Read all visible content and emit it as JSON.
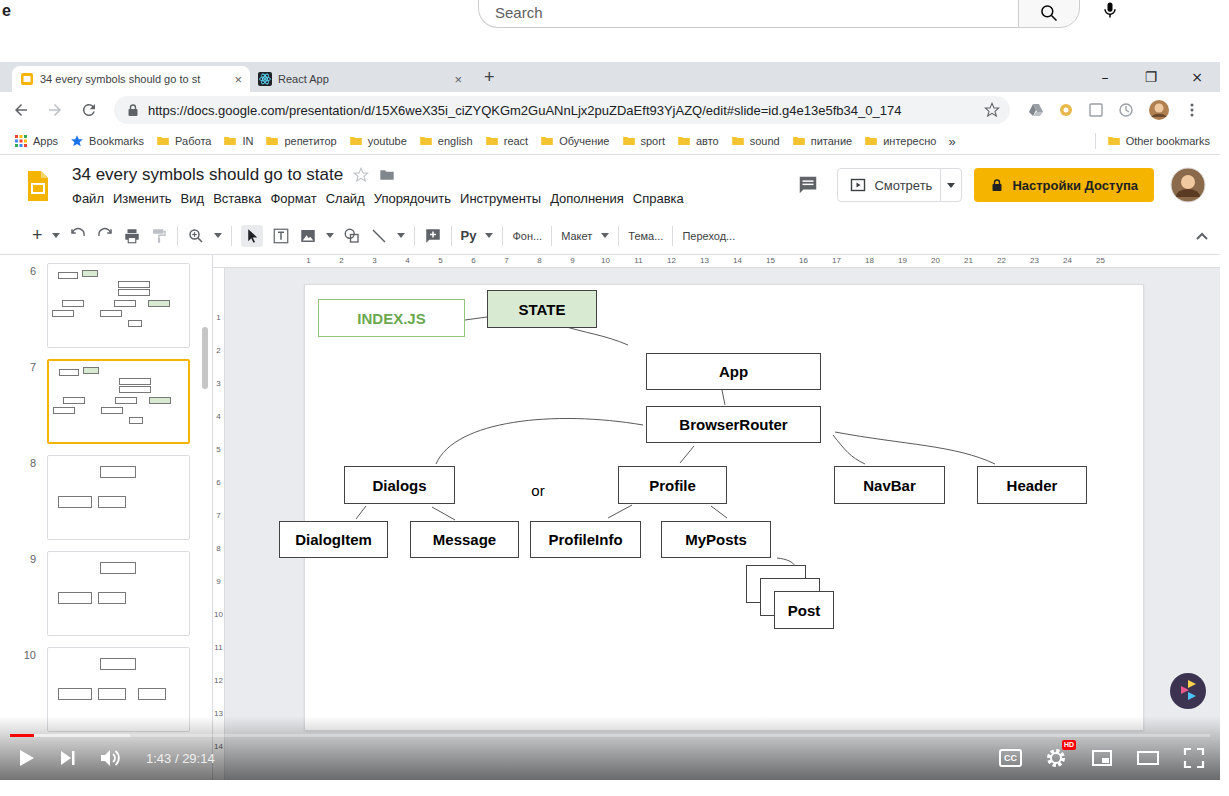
{
  "youtube": {
    "logo_fragment": "e",
    "search": {
      "placeholder": "Search"
    }
  },
  "browser": {
    "tabs": [
      {
        "label": "34 every symbols should go to st",
        "selected": true,
        "kind": "slides"
      },
      {
        "label": "React App",
        "selected": false,
        "kind": "react"
      }
    ],
    "tab_close": "×",
    "new_tab": "+",
    "window_controls": [
      "–",
      "❐",
      "×"
    ],
    "url": "https://docs.google.com/presentation/d/15X6weX35i_ciZYQKGm2GuANnLjx2puZDaEft93YjAZQ/edit#slide=id.g4e13e5fb34_0_174",
    "bookmarks": [
      {
        "label": "Apps",
        "kind": "apps"
      },
      {
        "label": "Bookmarks",
        "kind": "star"
      },
      {
        "label": "Работа",
        "kind": "folder"
      },
      {
        "label": "IN",
        "kind": "folder"
      },
      {
        "label": "репетитор",
        "kind": "folder"
      },
      {
        "label": "youtube",
        "kind": "folder"
      },
      {
        "label": "english",
        "kind": "folder"
      },
      {
        "label": "react",
        "kind": "folder"
      },
      {
        "label": "Обучение",
        "kind": "folder"
      },
      {
        "label": "sport",
        "kind": "folder"
      },
      {
        "label": "авто",
        "kind": "folder"
      },
      {
        "label": "sound",
        "kind": "folder"
      },
      {
        "label": "питание",
        "kind": "folder"
      },
      {
        "label": "интересно",
        "kind": "folder"
      },
      {
        "label": "»",
        "kind": "more"
      }
    ],
    "other_bookmarks": "Other bookmarks"
  },
  "slides": {
    "title": "34 every symbols should go to state",
    "menu": [
      "Файл",
      "Изменить",
      "Вид",
      "Вставка",
      "Формат",
      "Слайд",
      "Упорядочить",
      "Инструменты",
      "Дополнения",
      "Справка"
    ],
    "present_button": "Смотреть",
    "share_button": "Настройки Доступа",
    "toolbar": {
      "new": "+",
      "input_tool": "Ру",
      "background": "Фон...",
      "layout": "Макет",
      "theme": "Тема...",
      "transition": "Переход..."
    },
    "ruler_horizontal": [
      "1",
      "2",
      "3",
      "4",
      "5",
      "6",
      "7",
      "8",
      "9",
      "10",
      "11",
      "12",
      "13",
      "14",
      "15",
      "16",
      "17",
      "18",
      "19",
      "20",
      "21",
      "22",
      "23",
      "24",
      "25"
    ],
    "ruler_vertical": [
      "1",
      "2",
      "3",
      "4",
      "5",
      "6",
      "7",
      "8",
      "9",
      "10",
      "11",
      "12",
      "13",
      "14"
    ],
    "filmstrip": [
      {
        "number": "6",
        "selected": false,
        "kind": "tree"
      },
      {
        "number": "7",
        "selected": true,
        "kind": "tree"
      },
      {
        "number": "8",
        "selected": false,
        "kind": "pair"
      },
      {
        "number": "9",
        "selected": false,
        "kind": "pair"
      },
      {
        "number": "10",
        "selected": false,
        "kind": "triple"
      }
    ],
    "diagram": {
      "nodes": [
        {
          "label": "INDEX.JS",
          "kind": "entry"
        },
        {
          "label": "STATE",
          "kind": "state"
        },
        {
          "label": "App",
          "kind": "box"
        },
        {
          "label": "BrowserRouter",
          "kind": "box"
        },
        {
          "label": "Dialogs",
          "kind": "box"
        },
        {
          "label": "or",
          "kind": "text"
        },
        {
          "label": "Profile",
          "kind": "box"
        },
        {
          "label": "NavBar",
          "kind": "box"
        },
        {
          "label": "Header",
          "kind": "box"
        },
        {
          "label": "DialogItem",
          "kind": "box"
        },
        {
          "label": "Message",
          "kind": "box"
        },
        {
          "label": "ProfileInfo",
          "kind": "box"
        },
        {
          "label": "MyPosts",
          "kind": "box"
        },
        {
          "label": "Post",
          "kind": "stack"
        }
      ]
    }
  },
  "player": {
    "time": "1:43 / 29:14",
    "level": 0.02,
    "buffered": 0.1,
    "cc": "CC",
    "hd_badge": "HD"
  }
}
